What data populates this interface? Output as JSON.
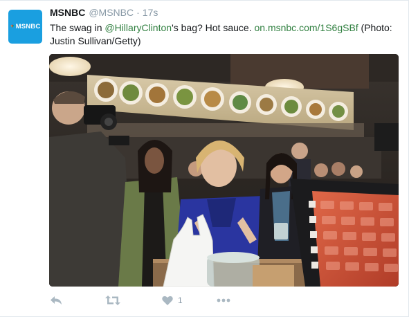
{
  "avatar": {
    "text": "MSNBC",
    "color": "#1a9fe0"
  },
  "header": {
    "name": "MSNBC",
    "handle": "@MSNBC",
    "separator": "·",
    "time": "17s"
  },
  "tweet": {
    "text_1": "The swag in ",
    "mention": "@HillaryClinton",
    "text_2": "'s bag? Hot sauce. ",
    "link": "on.msnbc.com/1S6gSBf",
    "text_3": " (Photo: Justin Sullivan/Getty)",
    "link_color": "#2f7f3f"
  },
  "photo": {
    "description_icon": "photo-image",
    "register_screen": {
      "rows": 6,
      "columns": 4
    }
  },
  "actions": {
    "reply_icon": "reply-icon",
    "retweet_icon": "retweet-icon",
    "like_icon": "heart-icon",
    "like_count": "1",
    "more_icon": "more-icon"
  }
}
